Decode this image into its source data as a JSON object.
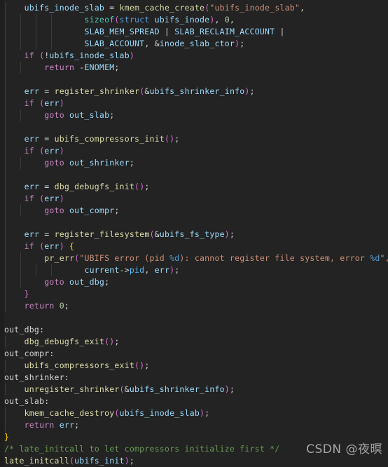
{
  "editor": {
    "background": "#232323",
    "language": "c",
    "font_size_px": 11.5,
    "line_height_px": 17
  },
  "watermark": {
    "text": "CSDN @夜暝",
    "color": "#b8b8b8"
  },
  "colors": {
    "keyword": "#c586c0",
    "function": "#dcdcaa",
    "variable": "#9cdcfe",
    "member": "#4fc1ff",
    "type": "#4ec9b0",
    "string": "#ce9178",
    "format_spec": "#569cd6",
    "number": "#b5cea8",
    "operator": "#d4d4d4",
    "paren": "#da70d6",
    "brace": "#ffd700",
    "comment": "#6a9955",
    "background": "#232323",
    "indent_guide": "#3b3b3b"
  },
  "code": {
    "plain_text": "    ubifs_inode_slab = kmem_cache_create(\"ubifs_inode_slab\",\n                sizeof(struct ubifs_inode), 0,\n                SLAB_MEM_SPREAD | SLAB_RECLAIM_ACCOUNT |\n                SLAB_ACCOUNT, &inode_slab_ctor);\n    if (!ubifs_inode_slab)\n        return -ENOMEM;\n\n    err = register_shrinker(&ubifs_shrinker_info);\n    if (err)\n        goto out_slab;\n\n    err = ubifs_compressors_init();\n    if (err)\n        goto out_shrinker;\n\n    err = dbg_debugfs_init();\n    if (err)\n        goto out_compr;\n\n    err = register_filesystem(&ubifs_fs_type);\n    if (err) {\n        pr_err(\"UBIFS error (pid %d): cannot register file system, error %d\",\n                current->pid, err);\n        goto out_dbg;\n    }\n    return 0;\n\nout_dbg:\n    dbg_debugfs_exit();\nout_compr:\n    ubifs_compressors_exit();\nout_shrinker:\n    unregister_shrinker(&ubifs_shrinker_info);\nout_slab:\n    kmem_cache_destroy(ubifs_inode_slab);\n    return err;\n}\n/* late_initcall to let compressors initialize first */\nlate_initcall(ubifs_init);",
    "lines": [
      {
        "n": 1,
        "guides": [
          0
        ],
        "tokens": [
          {
            "t": "    ",
            "c": "op"
          },
          {
            "t": "ubifs_inode_slab",
            "c": "var"
          },
          {
            "t": " = ",
            "c": "op"
          },
          {
            "t": "kmem_cache_create",
            "c": "fn"
          },
          {
            "t": "(",
            "c": "punc"
          },
          {
            "t": "\"ubifs_inode_slab\"",
            "c": "str"
          },
          {
            "t": ",",
            "c": "op"
          }
        ]
      },
      {
        "n": 2,
        "guides": [
          0,
          1,
          2,
          3
        ],
        "tokens": [
          {
            "t": "                ",
            "c": "op"
          },
          {
            "t": "sizeof",
            "c": "type"
          },
          {
            "t": "(",
            "c": "punc"
          },
          {
            "t": "struct",
            "c": "sk"
          },
          {
            "t": " ubifs_inode",
            "c": "var"
          },
          {
            "t": ")",
            "c": "punc"
          },
          {
            "t": ", ",
            "c": "op"
          },
          {
            "t": "0",
            "c": "num"
          },
          {
            "t": ",",
            "c": "op"
          }
        ]
      },
      {
        "n": 3,
        "guides": [
          0,
          1,
          2,
          3
        ],
        "tokens": [
          {
            "t": "                ",
            "c": "op"
          },
          {
            "t": "SLAB_MEM_SPREAD",
            "c": "var"
          },
          {
            "t": " | ",
            "c": "op"
          },
          {
            "t": "SLAB_RECLAIM_ACCOUNT",
            "c": "var"
          },
          {
            "t": " |",
            "c": "op"
          }
        ]
      },
      {
        "n": 4,
        "guides": [
          0,
          1,
          2,
          3
        ],
        "tokens": [
          {
            "t": "                ",
            "c": "op"
          },
          {
            "t": "SLAB_ACCOUNT",
            "c": "var"
          },
          {
            "t": ", &",
            "c": "op"
          },
          {
            "t": "inode_slab_ctor",
            "c": "var"
          },
          {
            "t": ")",
            "c": "punc"
          },
          {
            "t": ";",
            "c": "op"
          }
        ]
      },
      {
        "n": 5,
        "guides": [
          0
        ],
        "tokens": [
          {
            "t": "    ",
            "c": "op"
          },
          {
            "t": "if",
            "c": "kw"
          },
          {
            "t": " ",
            "c": "op"
          },
          {
            "t": "(",
            "c": "punc"
          },
          {
            "t": "!",
            "c": "op"
          },
          {
            "t": "ubifs_inode_slab",
            "c": "var"
          },
          {
            "t": ")",
            "c": "punc"
          }
        ]
      },
      {
        "n": 6,
        "guides": [
          0,
          1
        ],
        "tokens": [
          {
            "t": "        ",
            "c": "op"
          },
          {
            "t": "return",
            "c": "kw"
          },
          {
            "t": " -",
            "c": "op"
          },
          {
            "t": "ENOMEM",
            "c": "var"
          },
          {
            "t": ";",
            "c": "op"
          }
        ]
      },
      {
        "n": 7,
        "guides": [
          0
        ],
        "tokens": []
      },
      {
        "n": 8,
        "guides": [
          0
        ],
        "tokens": [
          {
            "t": "    ",
            "c": "op"
          },
          {
            "t": "err",
            "c": "var"
          },
          {
            "t": " = ",
            "c": "op"
          },
          {
            "t": "register_shrinker",
            "c": "fn"
          },
          {
            "t": "(",
            "c": "punc"
          },
          {
            "t": "&",
            "c": "op"
          },
          {
            "t": "ubifs_shrinker_info",
            "c": "var"
          },
          {
            "t": ")",
            "c": "punc"
          },
          {
            "t": ";",
            "c": "op"
          }
        ]
      },
      {
        "n": 9,
        "guides": [
          0
        ],
        "tokens": [
          {
            "t": "    ",
            "c": "op"
          },
          {
            "t": "if",
            "c": "kw"
          },
          {
            "t": " ",
            "c": "op"
          },
          {
            "t": "(",
            "c": "punc"
          },
          {
            "t": "err",
            "c": "var"
          },
          {
            "t": ")",
            "c": "punc"
          }
        ]
      },
      {
        "n": 10,
        "guides": [
          0,
          1
        ],
        "tokens": [
          {
            "t": "        ",
            "c": "op"
          },
          {
            "t": "goto",
            "c": "kw"
          },
          {
            "t": " ",
            "c": "op"
          },
          {
            "t": "out_slab",
            "c": "var"
          },
          {
            "t": ";",
            "c": "op"
          }
        ]
      },
      {
        "n": 11,
        "guides": [
          0
        ],
        "tokens": []
      },
      {
        "n": 12,
        "guides": [
          0
        ],
        "tokens": [
          {
            "t": "    ",
            "c": "op"
          },
          {
            "t": "err",
            "c": "var"
          },
          {
            "t": " = ",
            "c": "op"
          },
          {
            "t": "ubifs_compressors_init",
            "c": "fn"
          },
          {
            "t": "(",
            "c": "punc"
          },
          {
            "t": ")",
            "c": "punc"
          },
          {
            "t": ";",
            "c": "op"
          }
        ]
      },
      {
        "n": 13,
        "guides": [
          0
        ],
        "tokens": [
          {
            "t": "    ",
            "c": "op"
          },
          {
            "t": "if",
            "c": "kw"
          },
          {
            "t": " ",
            "c": "op"
          },
          {
            "t": "(",
            "c": "punc"
          },
          {
            "t": "err",
            "c": "var"
          },
          {
            "t": ")",
            "c": "punc"
          }
        ]
      },
      {
        "n": 14,
        "guides": [
          0,
          1
        ],
        "tokens": [
          {
            "t": "        ",
            "c": "op"
          },
          {
            "t": "goto",
            "c": "kw"
          },
          {
            "t": " ",
            "c": "op"
          },
          {
            "t": "out_shrinker",
            "c": "var"
          },
          {
            "t": ";",
            "c": "op"
          }
        ]
      },
      {
        "n": 15,
        "guides": [
          0
        ],
        "tokens": []
      },
      {
        "n": 16,
        "guides": [
          0
        ],
        "tokens": [
          {
            "t": "    ",
            "c": "op"
          },
          {
            "t": "err",
            "c": "var"
          },
          {
            "t": " = ",
            "c": "op"
          },
          {
            "t": "dbg_debugfs_init",
            "c": "fn"
          },
          {
            "t": "(",
            "c": "punc"
          },
          {
            "t": ")",
            "c": "punc"
          },
          {
            "t": ";",
            "c": "op"
          }
        ]
      },
      {
        "n": 17,
        "guides": [
          0
        ],
        "tokens": [
          {
            "t": "    ",
            "c": "op"
          },
          {
            "t": "if",
            "c": "kw"
          },
          {
            "t": " ",
            "c": "op"
          },
          {
            "t": "(",
            "c": "punc"
          },
          {
            "t": "err",
            "c": "var"
          },
          {
            "t": ")",
            "c": "punc"
          }
        ]
      },
      {
        "n": 18,
        "guides": [
          0,
          1
        ],
        "tokens": [
          {
            "t": "        ",
            "c": "op"
          },
          {
            "t": "goto",
            "c": "kw"
          },
          {
            "t": " ",
            "c": "op"
          },
          {
            "t": "out_compr",
            "c": "var"
          },
          {
            "t": ";",
            "c": "op"
          }
        ]
      },
      {
        "n": 19,
        "guides": [
          0
        ],
        "tokens": []
      },
      {
        "n": 20,
        "guides": [
          0
        ],
        "tokens": [
          {
            "t": "    ",
            "c": "op"
          },
          {
            "t": "err",
            "c": "var"
          },
          {
            "t": " = ",
            "c": "op"
          },
          {
            "t": "register_filesystem",
            "c": "fn"
          },
          {
            "t": "(",
            "c": "punc"
          },
          {
            "t": "&",
            "c": "op"
          },
          {
            "t": "ubifs_fs_type",
            "c": "var"
          },
          {
            "t": ")",
            "c": "punc"
          },
          {
            "t": ";",
            "c": "op"
          }
        ]
      },
      {
        "n": 21,
        "guides": [
          0
        ],
        "tokens": [
          {
            "t": "    ",
            "c": "op"
          },
          {
            "t": "if",
            "c": "kw"
          },
          {
            "t": " ",
            "c": "op"
          },
          {
            "t": "(",
            "c": "punc"
          },
          {
            "t": "err",
            "c": "var"
          },
          {
            "t": ")",
            "c": "punc"
          },
          {
            "t": " ",
            "c": "op"
          },
          {
            "t": "{",
            "c": "brace"
          }
        ]
      },
      {
        "n": 22,
        "guides": [
          0,
          1
        ],
        "tokens": [
          {
            "t": "        ",
            "c": "op"
          },
          {
            "t": "pr_err",
            "c": "fn"
          },
          {
            "t": "(",
            "c": "punc"
          },
          {
            "t": "\"UBIFS error (pid ",
            "c": "str"
          },
          {
            "t": "%d",
            "c": "fmt"
          },
          {
            "t": "): cannot register file system, error ",
            "c": "str"
          },
          {
            "t": "%d",
            "c": "fmt"
          },
          {
            "t": "\",",
            "c": "str"
          }
        ]
      },
      {
        "n": 23,
        "guides": [
          0,
          1,
          2,
          3
        ],
        "tokens": [
          {
            "t": "                ",
            "c": "op"
          },
          {
            "t": "current",
            "c": "var"
          },
          {
            "t": "->",
            "c": "op"
          },
          {
            "t": "pid",
            "c": "varb"
          },
          {
            "t": ", ",
            "c": "op"
          },
          {
            "t": "err",
            "c": "var"
          },
          {
            "t": ")",
            "c": "punc"
          },
          {
            "t": ";",
            "c": "op"
          }
        ]
      },
      {
        "n": 24,
        "guides": [
          0,
          1
        ],
        "tokens": [
          {
            "t": "        ",
            "c": "op"
          },
          {
            "t": "goto",
            "c": "kw"
          },
          {
            "t": " ",
            "c": "op"
          },
          {
            "t": "out_dbg",
            "c": "var"
          },
          {
            "t": ";",
            "c": "op"
          }
        ]
      },
      {
        "n": 25,
        "guides": [
          0
        ],
        "tokens": [
          {
            "t": "    ",
            "c": "op"
          },
          {
            "t": "}",
            "c": "punc"
          }
        ]
      },
      {
        "n": 26,
        "guides": [
          0
        ],
        "tokens": [
          {
            "t": "    ",
            "c": "op"
          },
          {
            "t": "return",
            "c": "kw"
          },
          {
            "t": " ",
            "c": "op"
          },
          {
            "t": "0",
            "c": "num"
          },
          {
            "t": ";",
            "c": "op"
          }
        ]
      },
      {
        "n": 27,
        "guides": [],
        "tokens": []
      },
      {
        "n": 28,
        "guides": [],
        "tokens": [
          {
            "t": "out_dbg",
            "c": "lbl"
          },
          {
            "t": ":",
            "c": "op"
          }
        ]
      },
      {
        "n": 29,
        "guides": [
          0
        ],
        "tokens": [
          {
            "t": "    ",
            "c": "op"
          },
          {
            "t": "dbg_debugfs_exit",
            "c": "fn"
          },
          {
            "t": "(",
            "c": "punc"
          },
          {
            "t": ")",
            "c": "punc"
          },
          {
            "t": ";",
            "c": "op"
          }
        ]
      },
      {
        "n": 30,
        "guides": [],
        "tokens": [
          {
            "t": "out_compr",
            "c": "lbl"
          },
          {
            "t": ":",
            "c": "op"
          }
        ]
      },
      {
        "n": 31,
        "guides": [
          0
        ],
        "tokens": [
          {
            "t": "    ",
            "c": "op"
          },
          {
            "t": "ubifs_compressors_exit",
            "c": "fn"
          },
          {
            "t": "(",
            "c": "punc"
          },
          {
            "t": ")",
            "c": "punc"
          },
          {
            "t": ";",
            "c": "op"
          }
        ]
      },
      {
        "n": 32,
        "guides": [],
        "tokens": [
          {
            "t": "out_shrinker",
            "c": "lbl"
          },
          {
            "t": ":",
            "c": "op"
          }
        ]
      },
      {
        "n": 33,
        "guides": [
          0
        ],
        "tokens": [
          {
            "t": "    ",
            "c": "op"
          },
          {
            "t": "unregister_shrinker",
            "c": "fn"
          },
          {
            "t": "(",
            "c": "punc"
          },
          {
            "t": "&",
            "c": "op"
          },
          {
            "t": "ubifs_shrinker_info",
            "c": "var"
          },
          {
            "t": ")",
            "c": "punc"
          },
          {
            "t": ";",
            "c": "op"
          }
        ]
      },
      {
        "n": 34,
        "guides": [],
        "tokens": [
          {
            "t": "out_slab",
            "c": "lbl"
          },
          {
            "t": ":",
            "c": "op"
          }
        ]
      },
      {
        "n": 35,
        "guides": [
          0
        ],
        "tokens": [
          {
            "t": "    ",
            "c": "op"
          },
          {
            "t": "kmem_cache_destroy",
            "c": "fn"
          },
          {
            "t": "(",
            "c": "punc"
          },
          {
            "t": "ubifs_inode_slab",
            "c": "var"
          },
          {
            "t": ")",
            "c": "punc"
          },
          {
            "t": ";",
            "c": "op"
          }
        ]
      },
      {
        "n": 36,
        "guides": [
          0
        ],
        "tokens": [
          {
            "t": "    ",
            "c": "op"
          },
          {
            "t": "return",
            "c": "kw"
          },
          {
            "t": " ",
            "c": "op"
          },
          {
            "t": "err",
            "c": "var"
          },
          {
            "t": ";",
            "c": "op"
          }
        ]
      },
      {
        "n": 37,
        "guides": [],
        "tokens": [
          {
            "t": "}",
            "c": "brace"
          }
        ]
      },
      {
        "n": 38,
        "guides": [],
        "tokens": [
          {
            "t": "/* late_initcall to let compressors initialize first */",
            "c": "cmt"
          }
        ]
      },
      {
        "n": 39,
        "guides": [],
        "tokens": [
          {
            "t": "late_initcall",
            "c": "fn"
          },
          {
            "t": "(",
            "c": "punc"
          },
          {
            "t": "ubifs_init",
            "c": "var"
          },
          {
            "t": ")",
            "c": "punc"
          },
          {
            "t": ";",
            "c": "op"
          }
        ]
      }
    ]
  }
}
